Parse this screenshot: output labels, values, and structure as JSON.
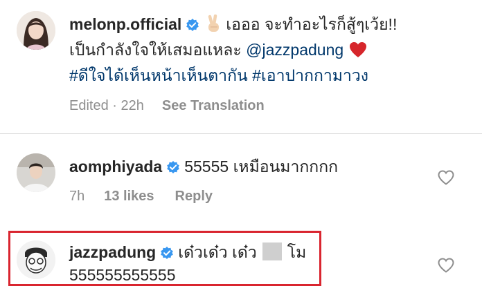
{
  "colors": {
    "text": "#262626",
    "muted": "#8e8e8e",
    "link": "#00376b",
    "verified": "#3897f0",
    "highlight_border": "#d9252f",
    "heart_red": "#d6262b"
  },
  "comments": [
    {
      "username": "melonp.official",
      "text_line1": "เอออ จะทำอะไรก็สู้ๆเว้ย!!",
      "text_line2_prefix": "เป็นกำลังใจให้เสมอแหละ ",
      "mention": "@jazzpadung",
      "hashtags": "#ดีใจได้เห็นหน้าเห็นตากัน #เอาปากกามาวง",
      "meta_time": "Edited · 22h",
      "meta_action": "See Translation",
      "icons": [
        "verified-badge",
        "victory-hand-emoji",
        "red-heart-emoji"
      ]
    },
    {
      "username": "aomphiyada",
      "text": "55555 เหมือนมากกกก",
      "meta_time": "7h",
      "meta_likes": "13 likes",
      "meta_action": "Reply",
      "icons": [
        "verified-badge",
        "heart-outline"
      ]
    },
    {
      "username": "jazzpadung",
      "text_part1": "เด๋วเด๋ว เด๋ว",
      "text_part2": "โม",
      "text_line2": "555555555555",
      "icons": [
        "verified-badge",
        "heart-outline"
      ]
    }
  ]
}
